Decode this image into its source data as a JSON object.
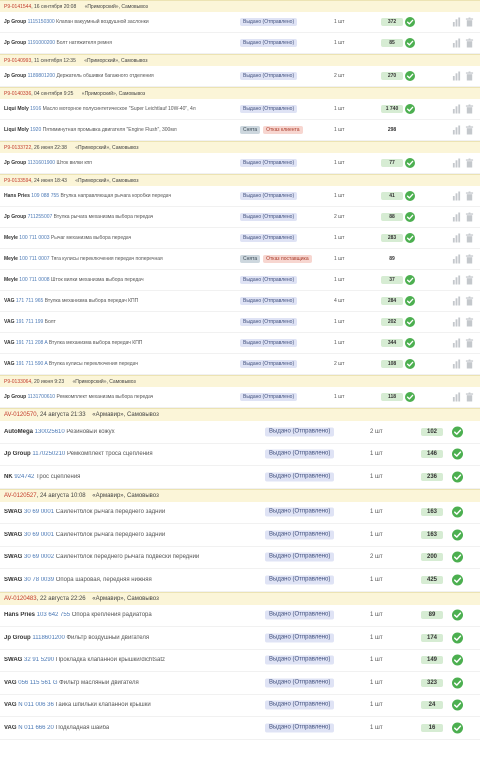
{
  "groups_small": [
    {
      "order": "P9-0141544",
      "date": "16 сентября 20:08",
      "location": "«Приморский», Самовывоз",
      "items": [
        {
          "brand": "Jp Group",
          "article": "1115150300",
          "desc": "Клапан вакуумный воздушной заслонки",
          "status": "Выдано (Отправлено)",
          "status_type": "blue",
          "qty": "1 шт",
          "sum": "372",
          "highlight": true,
          "check": true
        },
        {
          "brand": "Jp Group",
          "article": "1191000200",
          "desc": "Болт натяжителя ремня",
          "status": "Выдано (Отправлено)",
          "status_type": "blue",
          "qty": "1 шт",
          "sum": "85",
          "highlight": true,
          "check": true
        }
      ]
    },
    {
      "order": "P9-0140993",
      "date": "11 сентября 12:35",
      "location": "«Приморский», Самовывоз",
      "items": [
        {
          "brand": "Jp Group",
          "article": "1189801200",
          "desc": "Держатель обшивки багажного отделения",
          "status": "Выдано (Отправлено)",
          "status_type": "blue",
          "qty": "2 шт",
          "sum": "270",
          "highlight": true,
          "check": true
        }
      ]
    },
    {
      "order": "P9-0140336",
      "date": "04 сентября 9:25",
      "location": "«Приморский», Самовывоз",
      "items": [
        {
          "brand": "Liqui Moly",
          "article": "1916",
          "desc": "Масло моторное полусинтетическое \"Super Leichtlauf 10W-40\", 4л",
          "status": "Выдано (Отправлено)",
          "status_type": "blue",
          "qty": "1 шт",
          "sum": "1 740",
          "highlight": true,
          "check": true
        },
        {
          "brand": "Liqui Moly",
          "article": "1920",
          "desc": "Пятиминутная промывка двигателя \"Engine Flush\", 300мл",
          "status": "Снята",
          "status_type": "grey",
          "status2": "Отказ клиента",
          "qty": "1 шт",
          "sum": "298",
          "highlight": false,
          "check": false
        }
      ]
    },
    {
      "order": "P9-0133722",
      "date": "26 июня 22:38",
      "location": "«Приморский», Самовывоз",
      "items": [
        {
          "brand": "Jp Group",
          "article": "1131601900",
          "desc": "Шток вилки кпп",
          "status": "Выдано (Отправлено)",
          "status_type": "blue",
          "qty": "1 шт",
          "sum": "77",
          "highlight": true,
          "check": true
        }
      ]
    },
    {
      "order": "P9-0133594",
      "date": "24 июня 18:43",
      "location": "«Приморский», Самовывоз",
      "items": [
        {
          "brand": "Hans Pries",
          "article": "109 088 755",
          "desc": "Втулка направляющая рычага коробки передач",
          "status": "Выдано (Отправлено)",
          "status_type": "blue",
          "qty": "1 шт",
          "sum": "41",
          "highlight": true,
          "check": true
        },
        {
          "brand": "Jp Group",
          "article": "711255007",
          "desc": "Втулка рычага механизма выбора передач",
          "status": "Выдано (Отправлено)",
          "status_type": "blue",
          "qty": "2 шт",
          "sum": "88",
          "highlight": true,
          "check": true
        },
        {
          "brand": "Meyle",
          "article": "100 711 0003",
          "desc": "Рычаг механизма выбора передач",
          "status": "Выдано (Отправлено)",
          "status_type": "blue",
          "qty": "1 шт",
          "sum": "283",
          "highlight": true,
          "check": true
        },
        {
          "brand": "Meyle",
          "article": "100 711 0007",
          "desc": "Тяга кулисы переключения передач поперечная",
          "status": "Снята",
          "status_type": "grey",
          "status2": "Отказ поставщика",
          "qty": "1 шт",
          "sum": "89",
          "highlight": false,
          "check": false
        },
        {
          "brand": "Meyle",
          "article": "100 711 0008",
          "desc": "Шток вилки механизма выбора передач",
          "status": "Выдано (Отправлено)",
          "status_type": "blue",
          "qty": "1 шт",
          "sum": "37",
          "highlight": true,
          "check": true
        },
        {
          "brand": "VAG",
          "article": "171 711 965",
          "desc": "Втулка механизма выбора передач КПП",
          "status": "Выдано (Отправлено)",
          "status_type": "blue",
          "qty": "4 шт",
          "sum": "284",
          "highlight": true,
          "check": true
        },
        {
          "brand": "VAG",
          "article": "191 711 199",
          "desc": "Болт",
          "status": "Выдано (Отправлено)",
          "status_type": "blue",
          "qty": "1 шт",
          "sum": "202",
          "highlight": true,
          "check": true
        },
        {
          "brand": "VAG",
          "article": "191 711 208 A",
          "desc": "Втулка механизма выбора передач КПП",
          "status": "Выдано (Отправлено)",
          "status_type": "blue",
          "qty": "1 шт",
          "sum": "344",
          "highlight": true,
          "check": true
        },
        {
          "brand": "VAG",
          "article": "191 711 590 A",
          "desc": "Втулка кулисы переключения передач",
          "status": "Выдано (Отправлено)",
          "status_type": "blue",
          "qty": "2 шт",
          "sum": "108",
          "highlight": true,
          "check": true
        }
      ]
    },
    {
      "order": "P9-0133064",
      "date": "20 июня 9:23",
      "location": "«Приморский», Самовывоз",
      "items": [
        {
          "brand": "Jp Group",
          "article": "1131700610",
          "desc": "Ремкомплект механизма выбора передач",
          "status": "Выдано (Отправлено)",
          "status_type": "blue",
          "qty": "1 шт",
          "sum": "118",
          "highlight": true,
          "check": true
        }
      ]
    }
  ],
  "groups_large": [
    {
      "order": "AV-0120570",
      "date": "24 августа 21:33",
      "location": "«Армавир», Самовывоз",
      "items": [
        {
          "brand": "AutoMega",
          "article": "130025610",
          "desc": "Резиновый кожух",
          "status": "Выдано (Отправлено)",
          "qty": "2 шт",
          "sum": "102"
        },
        {
          "brand": "Jp Group",
          "article": "1170250210",
          "desc": "Ремкомплект троса сцепления",
          "status": "Выдано (Отправлено)",
          "qty": "1 шт",
          "sum": "146"
        },
        {
          "brand": "NK",
          "article": "924742",
          "desc": "Трос сцепления",
          "status": "Выдано (Отправлено)",
          "qty": "1 шт",
          "sum": "236"
        }
      ]
    },
    {
      "order": "AV-0120527",
      "date": "24 августа 10:08",
      "location": "«Армавир», Самовывоз",
      "items": [
        {
          "brand": "SWAG",
          "article": "30 69 0001",
          "desc": "Сайлентблок рычага переднего заднии",
          "status": "Выдано (Отправлено)",
          "qty": "1 шт",
          "sum": "163"
        },
        {
          "brand": "SWAG",
          "article": "30 69 0001",
          "desc": "Сайлентблок рычага переднего заднии",
          "status": "Выдано (Отправлено)",
          "qty": "1 шт",
          "sum": "163"
        },
        {
          "brand": "SWAG",
          "article": "30 69 0002",
          "desc": "Сайлентблок переднего рычага подвески передний",
          "status": "Выдано (Отправлено)",
          "qty": "2 шт",
          "sum": "200"
        },
        {
          "brand": "SWAG",
          "article": "30 78 0039",
          "desc": "Опора шаровая, передняя нижняя",
          "status": "Выдано (Отправлено)",
          "qty": "1 шт",
          "sum": "425"
        }
      ]
    },
    {
      "order": "AV-0120483",
      "date": "22 августа 22:26",
      "location": "«Армавир», Самовывоз",
      "items": [
        {
          "brand": "Hans Pries",
          "article": "103 642 755",
          "desc": "Опора крепления радиатора",
          "status": "Выдано (Отправлено)",
          "qty": "1 шт",
          "sum": "89"
        },
        {
          "brand": "Jp Group",
          "article": "1118601200",
          "desc": "Фильтр воздушный двигателя",
          "status": "Выдано (Отправлено)",
          "qty": "1 шт",
          "sum": "174"
        },
        {
          "brand": "SWAG",
          "article": "32 91 5290",
          "desc": "Прокладка клапанной крышки/dichtsatz",
          "status": "Выдано (Отправлено)",
          "qty": "1 шт",
          "sum": "149"
        },
        {
          "brand": "VAG",
          "article": "056 115 561 G",
          "desc": "Фильтр масляный двигателя",
          "status": "Выдано (Отправлено)",
          "qty": "1 шт",
          "sum": "323"
        },
        {
          "brand": "VAG",
          "article": "N 011 006 36",
          "desc": "Гайка шпильки клапанной крышки",
          "status": "Выдано (Отправлено)",
          "qty": "1 шт",
          "sum": "24"
        },
        {
          "brand": "VAG",
          "article": "N 011 666 20",
          "desc": "Подкладная шайба",
          "status": "Выдано (Отправлено)",
          "qty": "1 шт",
          "sum": "16"
        }
      ]
    }
  ],
  "colors": {
    "header_bg": "#fbf5d8",
    "order_red": "#c23a2b",
    "article_blue": "#4a78b5",
    "status_blue_bg": "#dfe3f5",
    "sum_green_bg": "#d6ecd3",
    "check_green": "#4caf50"
  },
  "icons": [
    "check-circle-icon",
    "bar-chart-icon",
    "trash-icon"
  ]
}
